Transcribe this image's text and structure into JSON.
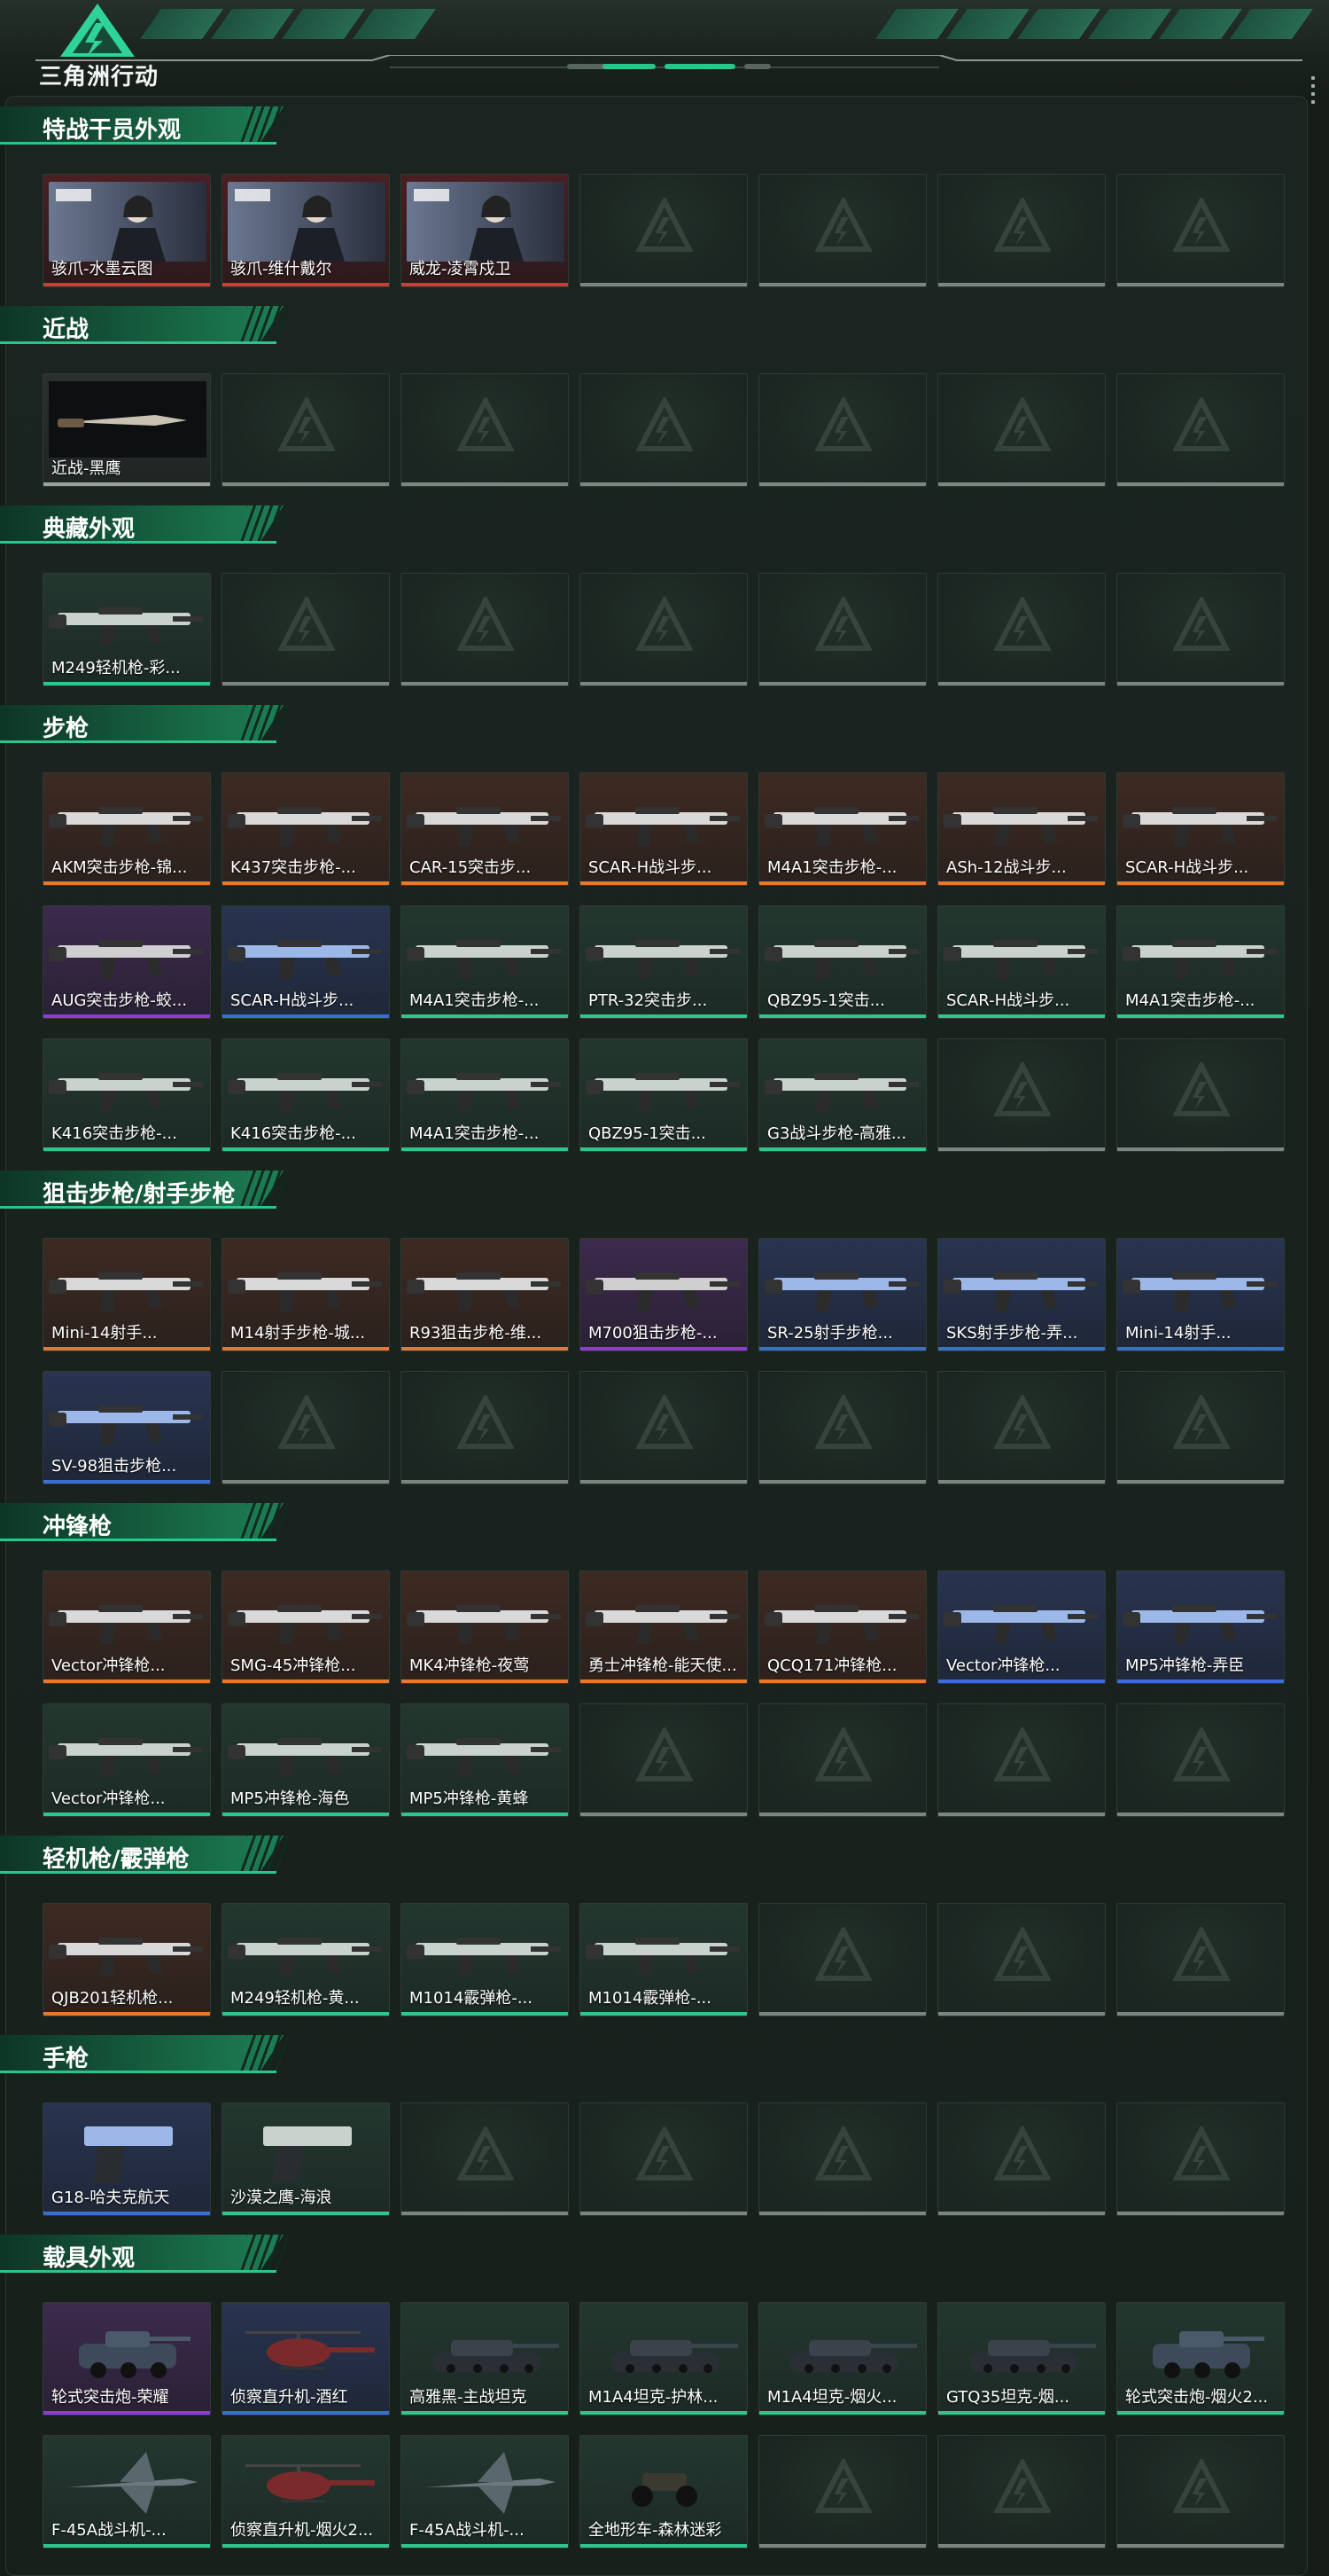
{
  "app": {
    "logo_text": "三角洲行动"
  },
  "colors": {
    "accent": "#2cc48a",
    "rarity_orange": "#e7782f",
    "rarity_purple": "#8a3dd8",
    "rarity_blue": "#3a6ed2",
    "rarity_green": "#2fc58b",
    "rarity_red": "#d23a3a",
    "empty": "#7c8580"
  },
  "sections": [
    {
      "title": "特战干员外观",
      "rows": 1,
      "items": [
        {
          "label": "骇爪-水墨云图",
          "rarity": "red",
          "icon": "operator-portrait"
        },
        {
          "label": "骇爪-维什戴尔",
          "rarity": "red",
          "icon": "operator-portrait"
        },
        {
          "label": "威龙-凌霄戍卫",
          "rarity": "red",
          "icon": "operator-portrait"
        }
      ]
    },
    {
      "title": "近战",
      "rows": 1,
      "items": [
        {
          "label": "近战-黑鹰",
          "rarity": "gray",
          "icon": "knife"
        }
      ]
    },
    {
      "title": "典藏外观",
      "rows": 1,
      "items": [
        {
          "label": "M249轻机枪-彩...",
          "rarity": "green",
          "icon": "machine-gun"
        }
      ]
    },
    {
      "title": "步枪",
      "rows": 3,
      "items": [
        {
          "label": "AKM突击步枪-锦...",
          "rarity": "orange",
          "icon": "rifle"
        },
        {
          "label": "K437突击步枪-...",
          "rarity": "orange",
          "icon": "rifle"
        },
        {
          "label": "CAR-15突击步...",
          "rarity": "orange",
          "icon": "rifle"
        },
        {
          "label": "SCAR-H战斗步...",
          "rarity": "orange",
          "icon": "rifle"
        },
        {
          "label": "M4A1突击步枪-...",
          "rarity": "orange",
          "icon": "rifle"
        },
        {
          "label": "ASh-12战斗步...",
          "rarity": "orange",
          "icon": "rifle"
        },
        {
          "label": "SCAR-H战斗步...",
          "rarity": "orange",
          "icon": "rifle"
        },
        {
          "label": "AUG突击步枪-蛟...",
          "rarity": "purple",
          "icon": "rifle"
        },
        {
          "label": "SCAR-H战斗步...",
          "rarity": "blue",
          "icon": "rifle"
        },
        {
          "label": "M4A1突击步枪-...",
          "rarity": "green",
          "icon": "rifle"
        },
        {
          "label": "PTR-32突击步...",
          "rarity": "green",
          "icon": "rifle"
        },
        {
          "label": "QBZ95-1突击...",
          "rarity": "green",
          "icon": "rifle"
        },
        {
          "label": "SCAR-H战斗步...",
          "rarity": "green",
          "icon": "rifle"
        },
        {
          "label": "M4A1突击步枪-...",
          "rarity": "green",
          "icon": "rifle"
        },
        {
          "label": "K416突击步枪-...",
          "rarity": "green",
          "icon": "rifle"
        },
        {
          "label": "K416突击步枪-...",
          "rarity": "green",
          "icon": "rifle"
        },
        {
          "label": "M4A1突击步枪-...",
          "rarity": "green",
          "icon": "rifle"
        },
        {
          "label": "QBZ95-1突击...",
          "rarity": "green",
          "icon": "rifle"
        },
        {
          "label": "G3战斗步枪-高雅...",
          "rarity": "green",
          "icon": "rifle"
        }
      ]
    },
    {
      "title": "狙击步枪/射手步枪",
      "rows": 2,
      "items": [
        {
          "label": "Mini-14射手...",
          "rarity": "orange",
          "icon": "sniper-rifle"
        },
        {
          "label": "M14射手步枪-城...",
          "rarity": "orange",
          "icon": "sniper-rifle"
        },
        {
          "label": "R93狙击步枪-维...",
          "rarity": "orange",
          "icon": "sniper-rifle"
        },
        {
          "label": "M700狙击步枪-...",
          "rarity": "purple",
          "icon": "sniper-rifle"
        },
        {
          "label": "SR-25射手步枪...",
          "rarity": "blue",
          "icon": "sniper-rifle"
        },
        {
          "label": "SKS射手步枪-弄...",
          "rarity": "blue",
          "icon": "sniper-rifle"
        },
        {
          "label": "Mini-14射手...",
          "rarity": "blue",
          "icon": "sniper-rifle"
        },
        {
          "label": "SV-98狙击步枪...",
          "rarity": "blue",
          "icon": "sniper-rifle"
        }
      ]
    },
    {
      "title": "冲锋枪",
      "rows": 2,
      "items": [
        {
          "label": "Vector冲锋枪...",
          "rarity": "orange",
          "icon": "smg"
        },
        {
          "label": "SMG-45冲锋枪...",
          "rarity": "orange",
          "icon": "smg"
        },
        {
          "label": "MK4冲锋枪-夜莺",
          "rarity": "orange",
          "icon": "smg"
        },
        {
          "label": "勇士冲锋枪-能天使...",
          "rarity": "orange",
          "icon": "smg"
        },
        {
          "label": "QCQ171冲锋枪...",
          "rarity": "orange",
          "icon": "smg"
        },
        {
          "label": "Vector冲锋枪...",
          "rarity": "blue",
          "icon": "smg"
        },
        {
          "label": "MP5冲锋枪-弄臣",
          "rarity": "blue",
          "icon": "smg"
        },
        {
          "label": "Vector冲锋枪...",
          "rarity": "green",
          "icon": "smg"
        },
        {
          "label": "MP5冲锋枪-海色",
          "rarity": "green",
          "icon": "smg"
        },
        {
          "label": "MP5冲锋枪-黄蜂",
          "rarity": "green",
          "icon": "smg"
        }
      ]
    },
    {
      "title": "轻机枪/霰弹枪",
      "rows": 1,
      "items": [
        {
          "label": "QJB201轻机枪...",
          "rarity": "orange",
          "icon": "machine-gun"
        },
        {
          "label": "M249轻机枪-黄...",
          "rarity": "green",
          "icon": "machine-gun"
        },
        {
          "label": "M1014霰弹枪-...",
          "rarity": "green",
          "icon": "shotgun"
        },
        {
          "label": "M1014霰弹枪-...",
          "rarity": "green",
          "icon": "shotgun"
        }
      ]
    },
    {
      "title": "手枪",
      "rows": 1,
      "items": [
        {
          "label": "G18-哈夫克航天",
          "rarity": "blue",
          "icon": "pistol"
        },
        {
          "label": "沙漠之鹰-海浪",
          "rarity": "green",
          "icon": "pistol"
        }
      ]
    },
    {
      "title": "载具外观",
      "rows": 2,
      "items": [
        {
          "label": "轮式突击炮-荣耀",
          "rarity": "purple",
          "icon": "armored-vehicle"
        },
        {
          "label": "侦察直升机-酒红",
          "rarity": "blue",
          "icon": "helicopter"
        },
        {
          "label": "高雅黑-主战坦克",
          "rarity": "green",
          "icon": "tank"
        },
        {
          "label": "M1A4坦克-护林...",
          "rarity": "green",
          "icon": "tank"
        },
        {
          "label": "M1A4坦克-烟火...",
          "rarity": "green",
          "icon": "tank"
        },
        {
          "label": "GTQ35坦克-烟...",
          "rarity": "green",
          "icon": "tank"
        },
        {
          "label": "轮式突击炮-烟火2...",
          "rarity": "green",
          "icon": "armored-vehicle"
        },
        {
          "label": "F-45A战斗机-...",
          "rarity": "green",
          "icon": "fighter-jet"
        },
        {
          "label": "侦察直升机-烟火2...",
          "rarity": "green",
          "icon": "helicopter"
        },
        {
          "label": "F-45A战斗机-...",
          "rarity": "green",
          "icon": "fighter-jet"
        },
        {
          "label": "全地形车-森林迷彩",
          "rarity": "green",
          "icon": "atv"
        }
      ]
    }
  ]
}
